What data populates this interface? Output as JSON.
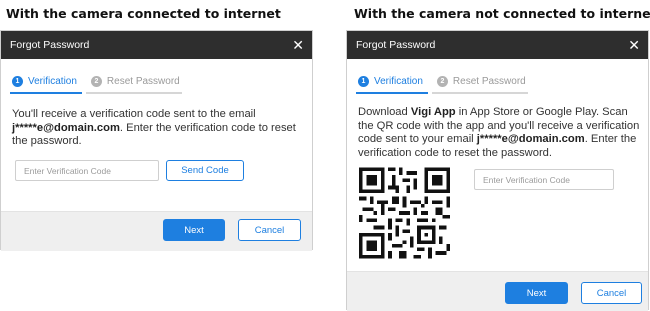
{
  "captions": {
    "left": "With the camera connected to internet",
    "right": "With the camera not connected to internet"
  },
  "dialog_left": {
    "title": "Forgot Password",
    "close_glyph": "✕",
    "steps": [
      {
        "num": "1",
        "label": "Verification"
      },
      {
        "num": "2",
        "label": "Reset Password"
      }
    ],
    "desc_prefix": "You'll receive a verification code sent to the email ",
    "email": "j*****e@domain.com",
    "desc_suffix": ". Enter the verification code to reset the password.",
    "input_placeholder": "Enter Verification Code",
    "send_code_label": "Send Code",
    "next_label": "Next",
    "cancel_label": "Cancel"
  },
  "dialog_right": {
    "title": "Forgot Password",
    "close_glyph": "✕",
    "steps": [
      {
        "num": "1",
        "label": "Verification"
      },
      {
        "num": "2",
        "label": "Reset Password"
      }
    ],
    "desc_1": "Download ",
    "app_name": "Vigi App",
    "desc_2": " in App Store or Google Play. Scan the QR code with the app and you'll receive a verification code sent to your email ",
    "email": "j*****e@domain.com",
    "desc_3": ". Enter the verification code to reset the password.",
    "input_placeholder": "Enter Verification Code",
    "next_label": "Next",
    "cancel_label": "Cancel"
  },
  "colors": {
    "accent": "#1e7fe0",
    "titlebar": "#2e2e2e",
    "footer": "#efefef"
  }
}
